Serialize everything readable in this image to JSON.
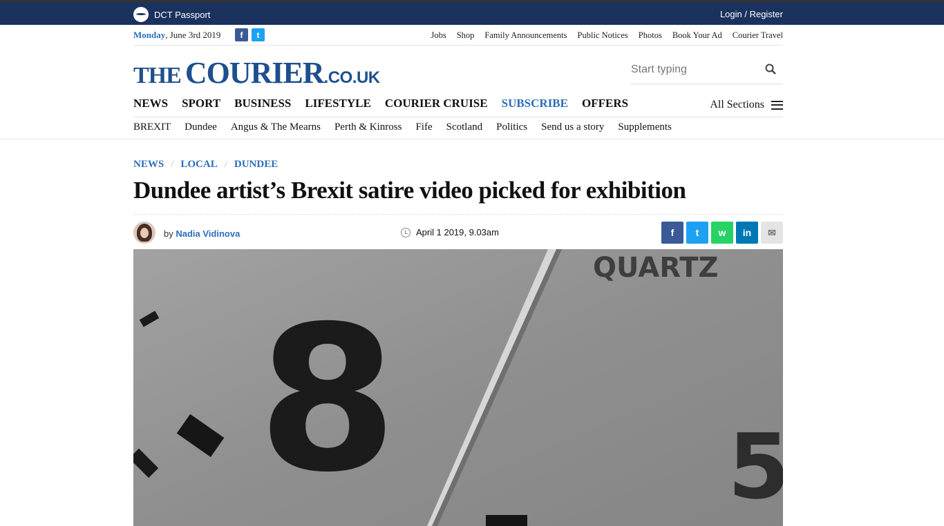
{
  "topbar": {
    "passport": "DCT Passport",
    "login": "Login / Register"
  },
  "utility": {
    "date_day": "Monday",
    "date_rest": ", June 3rd 2019",
    "social": [
      {
        "name": "facebook-icon",
        "glyph": "f",
        "color": "#3b5998"
      },
      {
        "name": "twitter-icon",
        "glyph": "t",
        "color": "#1da1f2"
      }
    ],
    "links": [
      "Jobs",
      "Shop",
      "Family Announcements",
      "Public Notices",
      "Photos",
      "Book Your Ad",
      "Courier Travel"
    ]
  },
  "logo": {
    "the": "THE",
    "courier": "COURIER",
    "couk": ".CO.UK"
  },
  "search": {
    "placeholder": "Start typing"
  },
  "mainnav": {
    "items": [
      "NEWS",
      "SPORT",
      "BUSINESS",
      "LIFESTYLE",
      "COURIER CRUISE",
      "SUBSCRIBE",
      "OFFERS"
    ],
    "highlight": "SUBSCRIBE",
    "all_sections": "All Sections"
  },
  "subnav": [
    "BREXIT",
    "Dundee",
    "Angus & The Mearns",
    "Perth & Kinross",
    "Fife",
    "Scotland",
    "Politics",
    "Send us a story",
    "Supplements"
  ],
  "article": {
    "crumbs": [
      "NEWS",
      "LOCAL",
      "DUNDEE"
    ],
    "headline": "Dundee artist’s Brexit satire video picked for exhibition",
    "by": "by",
    "author": "Nadia Vidinova",
    "time": "April 1 2019, 9.03am",
    "share": [
      {
        "name": "share-facebook-button",
        "glyph": "f",
        "color": "#3b5998"
      },
      {
        "name": "share-twitter-button",
        "glyph": "t",
        "color": "#1da1f2"
      },
      {
        "name": "share-whatsapp-button",
        "glyph": "w",
        "color": "#25d366"
      },
      {
        "name": "share-linkedin-button",
        "glyph": "in",
        "color": "#0077b5"
      },
      {
        "name": "share-email-button",
        "glyph": "✉",
        "color": "#e4e4e4"
      }
    ],
    "hero_text": {
      "number": "8",
      "brand": "QUARTZ",
      "number2": "5"
    }
  }
}
